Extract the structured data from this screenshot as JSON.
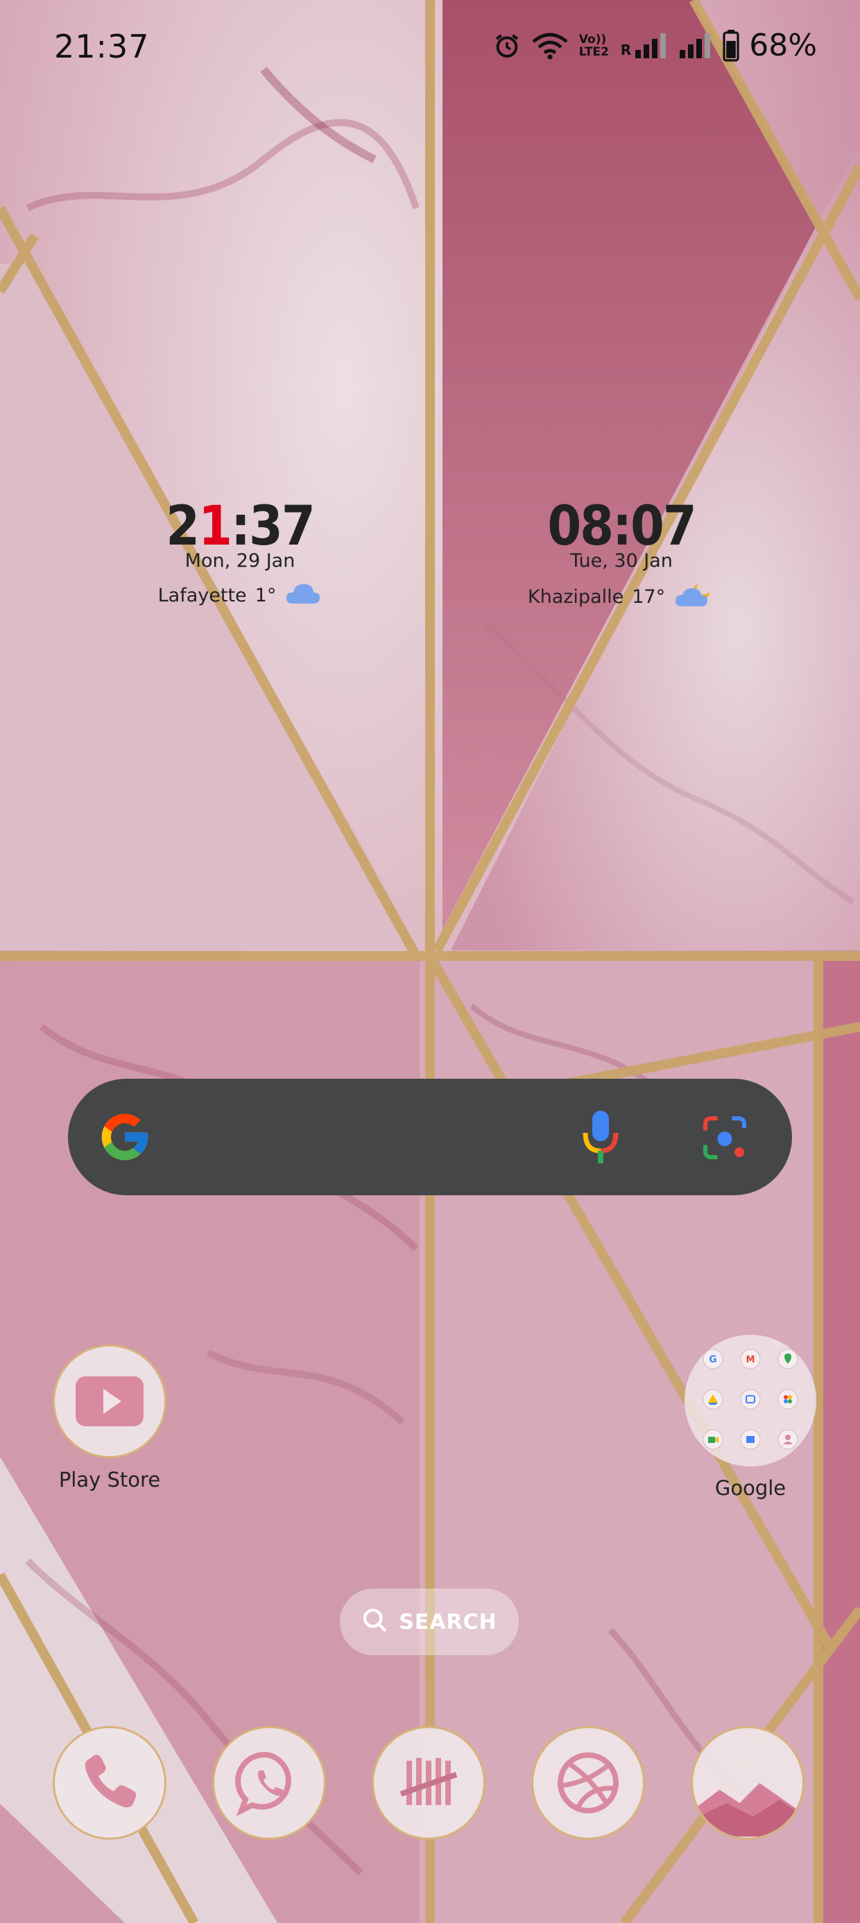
{
  "status_bar": {
    "time": "21:37",
    "battery": "68%",
    "icons": [
      "alarm-icon",
      "wifi-icon",
      "volte-icon",
      "signal-icon",
      "signal-icon",
      "battery-icon"
    ],
    "volte_label": "Vo))\nLTE2",
    "roaming_label": "R"
  },
  "widgets": [
    {
      "time_h1": "2",
      "time_h2": "1",
      "time_rest": ":37",
      "date": "Mon, 29 Jan",
      "location": "Lafayette",
      "temp": "1°",
      "weather_icon": "cloud-icon"
    },
    {
      "time": "08:07",
      "date": "Tue, 30 Jan",
      "location": "Khazipalle",
      "temp": "17°",
      "weather_icon": "partly-cloudy-night-icon"
    }
  ],
  "search_widget": {
    "icons": [
      "google-logo",
      "mic-icon",
      "lens-icon"
    ]
  },
  "apps": [
    {
      "label": "Play Store",
      "icon": "play-store-icon"
    },
    {
      "label": "Google",
      "icon": "google-folder"
    }
  ],
  "folder_apps": [
    "google-icon",
    "gmail-icon",
    "maps-icon",
    "drive-icon",
    "duo-icon",
    "photos-icon",
    "meet-icon",
    "news-icon",
    "contacts-icon"
  ],
  "app_search_label": "SEARCH",
  "dock": [
    {
      "icon": "phone-icon"
    },
    {
      "icon": "whatsapp-icon"
    },
    {
      "icon": "tally-icon"
    },
    {
      "icon": "dribbble-icon"
    },
    {
      "icon": "gallery-icon"
    }
  ],
  "colors": {
    "wallpaper_pink": "#d79aaa",
    "wallpaper_deep": "#b5576f",
    "gold_line": "#c9a46a",
    "search_bar": "#444648",
    "accent_red": "#e0001b"
  }
}
